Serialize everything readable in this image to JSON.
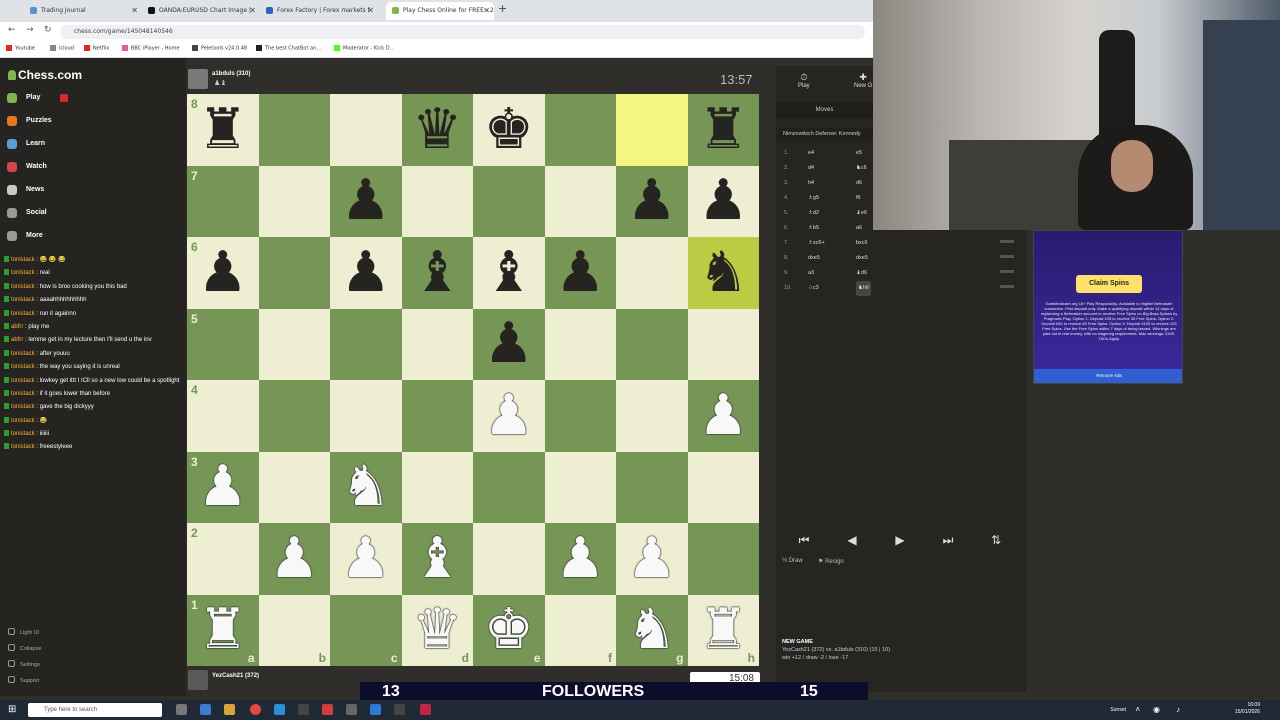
{
  "browser": {
    "tabs": [
      {
        "label": "Trading Journal",
        "color": "#5b8dd6",
        "active": false
      },
      {
        "label": "OANDA:EURUSD Chart Image |",
        "color": "#111111",
        "active": false
      },
      {
        "label": "Forex Factory | Forex markets f",
        "color": "#2b62c4",
        "active": false
      },
      {
        "label": "Play Chess Online for FREE - 2",
        "color": "#81b64c",
        "active": true
      }
    ],
    "url": "chess.com/game/145048140546",
    "bookmarks": [
      {
        "label": "Youtube",
        "color": "#e02828"
      },
      {
        "label": "icloud",
        "color": "#888888"
      },
      {
        "label": "Netflix",
        "color": "#e02828"
      },
      {
        "label": "BBC iPlayer - Home",
        "color": "#e05aa8"
      },
      {
        "label": "Peletools v24.0.48",
        "color": "#444444"
      },
      {
        "label": "The best ChatBot an...",
        "color": "#222222"
      },
      {
        "label": "Moderator - Kick D...",
        "color": "#53fc18"
      }
    ]
  },
  "site": {
    "name": "Chess.com"
  },
  "nav": [
    {
      "label": "Play",
      "color": "#81b64c",
      "badge": true
    },
    {
      "label": "Puzzles",
      "color": "#e87722",
      "badge": false
    },
    {
      "label": "Learn",
      "color": "#5a9be2",
      "badge": false
    },
    {
      "label": "Watch",
      "color": "#d64545",
      "badge": false
    },
    {
      "label": "News",
      "color": "#c9c9c9",
      "badge": false
    },
    {
      "label": "Social",
      "color": "#999999",
      "badge": false
    },
    {
      "label": "More",
      "color": "#999999",
      "badge": false
    }
  ],
  "chat": [
    {
      "user": "tonistack",
      "text": "😂 😂 😂"
    },
    {
      "user": "tonistack",
      "text": "real"
    },
    {
      "user": "tonistack",
      "text": "how is broo cooking you this bad"
    },
    {
      "user": "tonistack",
      "text": "aaaahhhhhhhhhh"
    },
    {
      "user": "tonistack",
      "text": "run it againnn"
    },
    {
      "user": "abfrr",
      "text": "play me"
    },
    {
      "user": "abfrr",
      "text": "lemme get in my lecture then I'll send u the inv"
    },
    {
      "user": "tonistack",
      "text": "after youuu"
    },
    {
      "user": "tonistack",
      "text": "the way you saying it is unreal"
    },
    {
      "user": "tonistack",
      "text": "lowkey get ittt I ICll so a new low could be a spotlight"
    },
    {
      "user": "tonistack",
      "text": "if it goes lower than before"
    },
    {
      "user": "tonistack",
      "text": "gave the big dickyyy"
    },
    {
      "user": "tonistack",
      "text": "😂"
    },
    {
      "user": "tonistack",
      "text": "iiiiiii"
    },
    {
      "user": "tonistack",
      "text": "freeestyleee"
    }
  ],
  "sidebar_footer": {
    "light": "Light UI",
    "collapse": "Collapse",
    "settings": "Settings",
    "support": "Support"
  },
  "game": {
    "top_player": {
      "name": "a1bduls (310)",
      "clock": "13:57"
    },
    "bottom_player": {
      "name": "YezCash21 (372)",
      "clock": "15:08"
    },
    "ranks": [
      "8",
      "7",
      "6",
      "5",
      "4",
      "3",
      "2",
      "1"
    ],
    "files": [
      "a",
      "b",
      "c",
      "d",
      "e",
      "f",
      "g",
      "h"
    ],
    "board": [
      [
        "r",
        "",
        "",
        "q",
        "k",
        "",
        "",
        "r"
      ],
      [
        "",
        "",
        "p",
        "",
        "",
        "",
        "p",
        "p"
      ],
      [
        "p",
        "",
        "p",
        "b",
        "b",
        "p",
        "",
        "n"
      ],
      [
        "",
        "",
        "",
        "",
        "p",
        "",
        "",
        ""
      ],
      [
        "",
        "",
        "",
        "",
        "P",
        "",
        "",
        "P"
      ],
      [
        "P",
        "",
        "N",
        "",
        "",
        "",
        "",
        ""
      ],
      [
        "",
        "P",
        "P",
        "B",
        "",
        "P",
        "P",
        ""
      ],
      [
        "R",
        "",
        "",
        "Q",
        "K",
        "",
        "N",
        "R"
      ]
    ],
    "highlights": [
      {
        "rank": 0,
        "file": 6,
        "kind": "from"
      },
      {
        "rank": 2,
        "file": 7,
        "kind": "to"
      }
    ]
  },
  "panel": {
    "tab_play": "Play",
    "tab_new": "New G",
    "moves_header": "Moves",
    "opening": "Nimzowitsch Defense: Kennedy",
    "moves": [
      {
        "n": "1.",
        "w": "e4",
        "b": "e5"
      },
      {
        "n": "2.",
        "w": "d4",
        "b": "♞c6"
      },
      {
        "n": "3.",
        "w": "h4",
        "b": "d6"
      },
      {
        "n": "4.",
        "w": "♗g5",
        "b": "f6"
      },
      {
        "n": "5.",
        "w": "♗d2",
        "b": "♝e6"
      },
      {
        "n": "6.",
        "w": "♗b5",
        "b": "a6"
      },
      {
        "n": "7.",
        "w": "♗xc6+",
        "b": "bxc6"
      },
      {
        "n": "8.",
        "w": "dxe5",
        "b": "dxe5"
      },
      {
        "n": "9.",
        "w": "a3",
        "b": "♝d6"
      },
      {
        "n": "10.",
        "w": "♘c3",
        "b": "♞h6"
      }
    ],
    "controls": [
      "⏮",
      "◀",
      "▶",
      "⏭"
    ],
    "draw": "Draw",
    "resign": "Resign",
    "new_game_title": "NEW GAME",
    "new_game_line1": "YezCash21 (372) vs. a1bduls (310) (15 | 10)",
    "new_game_line2": "win +12 / draw -2 / lose -17"
  },
  "ad": {
    "button": "Claim Spins",
    "text": "GambleAware.org 18+ Play Responsibly. Available to eligible Betmaster customers. First deposit only. Make a qualifying deposit within 14 days of registering a Betmaster account to receive Free Spins on Big Bass Splash by Pragmatic Play. Option 1: Deposit £35 to receive 35 Free Spins. Option 2: Deposit £60 to receive 65 Free Spins. Option 3: Deposit £100 to receive 125 Free Spins. Use the Free Spins within 7 days of being issued. Winnings are paid out in real money, with no wagering requirement. Max winnings: £100. T&Cs Apply.",
    "remove": "Remove Ads"
  },
  "banner": {
    "left": "13",
    "middle": "FOLLOWERS",
    "right": "15"
  },
  "taskbar": {
    "search": "Type here to search",
    "weather": "Sunset",
    "time": "16:09",
    "date": "15/01/2026"
  }
}
